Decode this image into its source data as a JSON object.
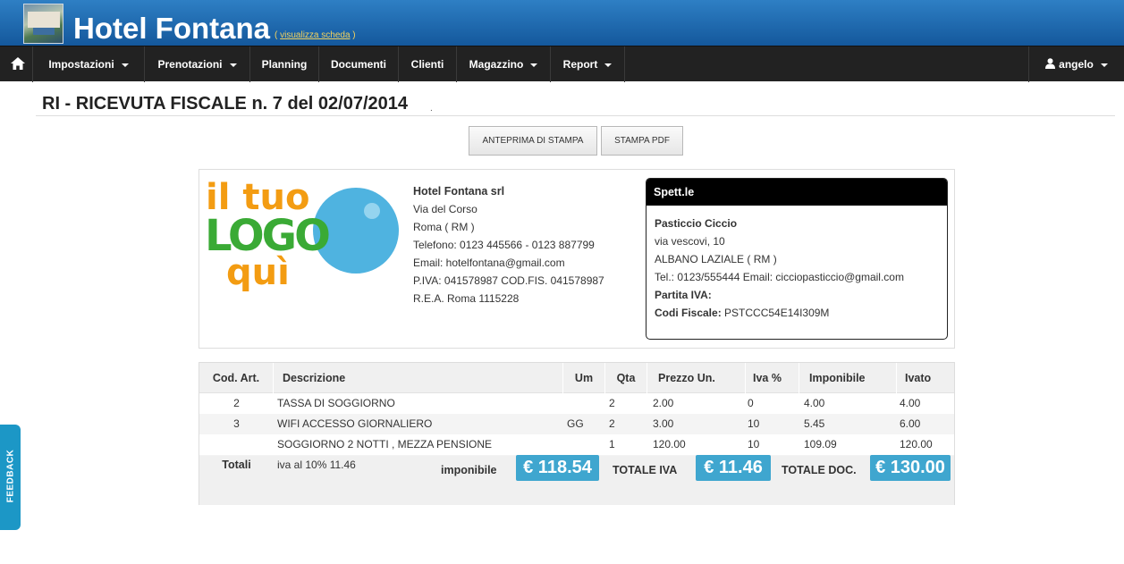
{
  "brand": {
    "title": "Hotel Fontana",
    "link_open": "(",
    "link_text": "visualizza scheda",
    "link_close": ")"
  },
  "nav": {
    "items": [
      {
        "label": "Impostazioni",
        "dropdown": true
      },
      {
        "label": "Prenotazioni",
        "dropdown": true
      },
      {
        "label": "Planning",
        "dropdown": false
      },
      {
        "label": "Documenti",
        "dropdown": false
      },
      {
        "label": "Clienti",
        "dropdown": false
      },
      {
        "label": "Magazzino",
        "dropdown": true
      },
      {
        "label": "Report",
        "dropdown": true
      }
    ],
    "user": "angelo"
  },
  "page": {
    "title": "RI - RICEVUTA FISCALE n. 7 del 02/07/2014",
    "title_suffix": "."
  },
  "buttons": {
    "preview": "ANTEPRIMA DI STAMPA",
    "pdf": "STAMPA PDF"
  },
  "logo": {
    "line1": "il tuo",
    "line2": "LOGO",
    "line3": "quì"
  },
  "company": {
    "name": "Hotel Fontana srl",
    "address": "Via del Corso",
    "city": "Roma ( RM )",
    "phone": "Telefono: 0123 445566 - 0123 887799",
    "email": "Email: hotelfontana@gmail.com",
    "vat": "P.IVA: 041578987 COD.FIS. 041578987",
    "rea": "R.E.A. Roma 1115228"
  },
  "customer": {
    "header": "Spett.le",
    "name": "Pasticcio Ciccio",
    "address": "via vescovi, 10",
    "city": "ALBANO LAZIALE ( RM )",
    "contacts": "Tel.: 0123/555444 Email: cicciopasticcio@gmail.com",
    "vat_label": "Partita IVA:",
    "vat_value": "",
    "fiscal_label": "Codi Fiscale:",
    "fiscal_value": "PSTCCC54E14I309M"
  },
  "table": {
    "columns": [
      "Cod. Art.",
      "Descrizione",
      "Um",
      "Qta",
      "Prezzo Un.",
      "Iva %",
      "Imponibile",
      "Ivato"
    ],
    "rows": [
      [
        "2",
        "TASSA DI SOGGIORNO",
        "",
        "2",
        "2.00",
        "0",
        "4.00",
        "4.00"
      ],
      [
        "3",
        "WIFI ACCESSO GIORNALIERO",
        "GG",
        "2",
        "3.00",
        "10",
        "5.45",
        "6.00"
      ],
      [
        "",
        "SOGGIORNO 2 NOTTI , MEZZA PENSIONE",
        "",
        "1",
        "120.00",
        "10",
        "109.09",
        "120.00"
      ]
    ]
  },
  "totals": {
    "label": "Totali",
    "iva_note": "iva al 10% 11.46",
    "imponibile_label": "imponibile",
    "imponibile_value": "€ 118.54",
    "iva_label": "TOTALE IVA",
    "iva_value": "€ 11.46",
    "doc_label": "TOTALE DOC.",
    "doc_value": "€ 130.00"
  },
  "feedback": "FEEDBACK",
  "colors": {
    "header_blue": "#1e6bb0",
    "navbar": "#222222",
    "accent_money": "#3fa6cf",
    "logo_green": "#3aaa35",
    "logo_orange": "#f39c12",
    "logo_blue": "#4fb3e0"
  }
}
